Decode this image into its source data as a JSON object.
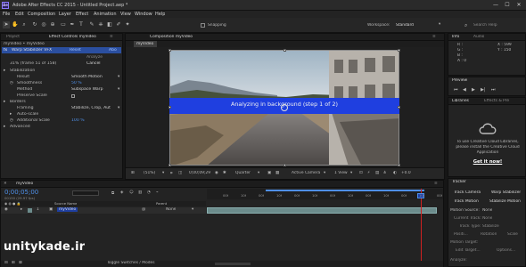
{
  "window": {
    "title": "Adobe After Effects CC 2015 - Untitled Project.aep *",
    "minimize": "—",
    "maximize": "☐",
    "close": "✕"
  },
  "menu": [
    "File",
    "Edit",
    "Composition",
    "Layer",
    "Effect",
    "Animation",
    "View",
    "Window",
    "Help"
  ],
  "toolbar": {
    "snapping_label": "Snapping",
    "workspace_label": "Workspace:",
    "workspace_value": "Standard",
    "search_placeholder": "Search Help"
  },
  "left_panel": {
    "tabs": [
      "Project",
      "Effect Controls myVideo"
    ],
    "breadcrumb": "myVideo • myVideo",
    "effect_name": "Warp Stabilizer VFX",
    "effect_reset": "Reset",
    "effect_about": "Abo",
    "analyze_button": "Analyze",
    "cancel_button": "Cancel",
    "progress_text": "31% (frame 51 of 158)",
    "rows": [
      {
        "label": "Stabilization",
        "value": "",
        "indent": 1,
        "kind": "group"
      },
      {
        "label": "Result",
        "value": "Smooth Motion",
        "indent": 2,
        "kind": "dropdown"
      },
      {
        "label": "Smoothness",
        "value": "50 %",
        "indent": 2,
        "kind": "number"
      },
      {
        "label": "Method",
        "value": "Subspace Warp",
        "indent": 2,
        "kind": "dropdown"
      },
      {
        "label": "Preserve Scale",
        "value": "",
        "indent": 2,
        "kind": "checkbox"
      },
      {
        "label": "Borders",
        "value": "",
        "indent": 1,
        "kind": "group"
      },
      {
        "label": "Framing",
        "value": "Stabilize, Crop, Aut",
        "indent": 2,
        "kind": "dropdown"
      },
      {
        "label": "Auto-scale",
        "value": "",
        "indent": 2,
        "kind": "group"
      },
      {
        "label": "Additional Scale",
        "value": "100 %",
        "indent": 2,
        "kind": "number"
      },
      {
        "label": "Advanced",
        "value": "",
        "indent": 1,
        "kind": "group"
      }
    ]
  },
  "composition": {
    "tab_label": "Composition myVideo",
    "sub_tab": "myVideo",
    "analyzing_text": "Analyzing in background (step 1 of 2)",
    "footer": {
      "zoom": "(51%)",
      "timecode": "0;00;09;29",
      "resolution": "Quarter",
      "camera": "Active Camera",
      "views": "1 View",
      "offset": "+0.0"
    }
  },
  "timeline": {
    "tab_label": "myVideo",
    "timecode": "0;00;05;00",
    "fps_label": "00150 (29.97 fps)",
    "columns": [
      "Source Name",
      "Parent"
    ],
    "layer": {
      "number": "1",
      "name": "myVideo",
      "parent": "None"
    },
    "ruler_labels": [
      "00f",
      "10f",
      "00f",
      "10f",
      "00f",
      "10f",
      "00f",
      "10f",
      "00f",
      "10f",
      "00f",
      "10f",
      "00f"
    ],
    "toggle_label": "Toggle Switches / Modes"
  },
  "info_panel": {
    "tabs": [
      "Info",
      "Audio"
    ],
    "r_label": "R :",
    "g_label": "G :",
    "b_label": "B :",
    "a_label": "A : 0",
    "x_readout": "X : 599",
    "y_readout": "Y : 150"
  },
  "preview_panel": {
    "title": "Preview"
  },
  "libraries_panel": {
    "tabs": [
      "Libraries",
      "Effects & Pre"
    ],
    "message": [
      "To use Creative Cloud Libraries,",
      "please install the Creative Cloud",
      "Application"
    ],
    "link": "Get it now!"
  },
  "tracker_panel": {
    "title": "Tracker",
    "buttons": [
      "Track Camera",
      "Warp Stabilizer",
      "Track Motion",
      "Stabilize Motion"
    ],
    "motion_source_label": "Motion Source:",
    "motion_source_value": "None",
    "current_track_label": "Current Track:",
    "current_track_value": "None",
    "track_type_label": "Track Type:",
    "track_type_value": "Stabilize",
    "position_label": "Positi...",
    "rotation_label": "Rotation",
    "scale_label": "Scale",
    "motion_target_label": "Motion Target:",
    "edit_target": "Edit Target...",
    "options": "Options...",
    "analyze_label": "Analyze:"
  },
  "watermark": "unitykade.ir",
  "colors": {
    "accent_blue": "#2b4fa0",
    "analyze_band": "#1f3fe0",
    "timecode_blue": "#4f8fe6",
    "layer_bar": "#6c8c8c",
    "playhead": "#d02020"
  }
}
